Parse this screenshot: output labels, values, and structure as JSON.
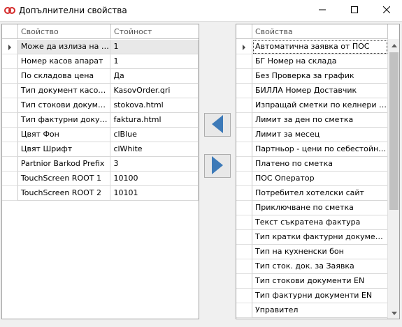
{
  "window": {
    "title": "Допълнителни свойства",
    "app_icon": "app-logo-icon",
    "controls": [
      "minimize-icon",
      "maximize-icon",
      "close-icon"
    ]
  },
  "left_grid": {
    "columns": [
      "Свойство",
      "Стойност"
    ],
    "rows": [
      {
        "name": "Може да излиза на ми...",
        "value": "1"
      },
      {
        "name": "Номер касов апарат",
        "value": "1"
      },
      {
        "name": "По складова цена",
        "value": "Да"
      },
      {
        "name": "Тип документ касови ...",
        "value": "KasovOrder.qri"
      },
      {
        "name": "Тип стокови документи",
        "value": "stokova.html"
      },
      {
        "name": "Тип фактурни докуме...",
        "value": "faktura.html"
      },
      {
        "name": "Цвят Фон",
        "value": "clBlue"
      },
      {
        "name": "Цвят Шрифт",
        "value": "clWhite"
      },
      {
        "name": "Partnior Barkod Prefix",
        "value": "3"
      },
      {
        "name": "TouchScreen ROOT 1",
        "value": "10100"
      },
      {
        "name": "TouchScreen ROOT 2",
        "value": "10101"
      }
    ]
  },
  "right_grid": {
    "column": "Свойства",
    "rows": [
      "Автоматична заявка от ПОС",
      "БГ Номер на склада",
      "Без Проверка за график",
      "БИЛЛА Номер Доставчик",
      "Изпращай сметки по келнери на м...",
      "Лимит за ден по сметка",
      "Лимит за месец",
      "Партньор - цени по себестойност",
      "Платено по сметка",
      "ПОС Оператор",
      "Потребител хотелски сайт",
      "Приключване по сметка",
      "Текст съкратена фактура",
      "Тип кратки фактурни документи",
      "Тип на кухненски бон",
      "Тип сток. док. за Заявка",
      "Тип стокови документи EN",
      "Тип фактурни документи EN",
      "Управител"
    ]
  },
  "buttons": {
    "move_left_icon": "arrow-left-icon",
    "move_right_icon": "arrow-right-icon"
  },
  "colors": {
    "arrow_blue": "#3d7ab8",
    "titlebar": "#ffffff",
    "window_bg": "#f0f0f0"
  }
}
